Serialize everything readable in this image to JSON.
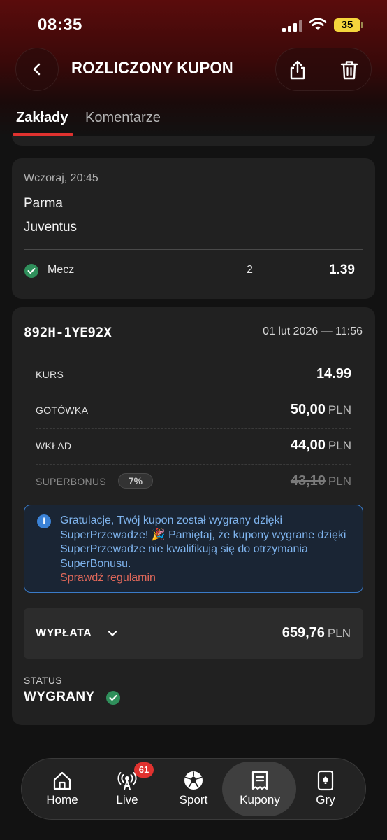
{
  "status_bar": {
    "time": "08:35",
    "battery": "35"
  },
  "header": {
    "title": "ROZLICZONY KUPON"
  },
  "tabs": [
    {
      "label": "Zakłady",
      "active": true
    },
    {
      "label": "Komentarze",
      "active": false
    }
  ],
  "bet": {
    "date": "Wczoraj, 20:45",
    "team_home": "Parma",
    "team_away": "Juventus",
    "market": "Mecz",
    "selection": "2",
    "odds": "1.39",
    "status_icon": "check-icon"
  },
  "coupon": {
    "id": "892H-1YE92X",
    "datetime": "01 lut 2026 — 11:56",
    "rows": {
      "kurs": {
        "label": "KURS",
        "value": "14.99"
      },
      "cash": {
        "label": "GOTÓWKA",
        "value": "50,00",
        "currency": "PLN"
      },
      "stake": {
        "label": "WKŁAD",
        "value": "44,00",
        "currency": "PLN"
      },
      "superbonus": {
        "label": "SUPERBONUS",
        "badge": "7%",
        "value": "43,10",
        "currency": "PLN"
      }
    },
    "info": {
      "text": "Gratulacje, Twój kupon został wygrany dzięki SuperPrzewadze! 🎉 Pamiętaj, że kupony wygrane dzięki SuperPrzewadze nie kwalifikują się do otrzymania SuperBonusu.",
      "link": "Sprawdź regulamin"
    },
    "payout": {
      "label": "WYPŁATA",
      "value": "659,76",
      "currency": "PLN"
    },
    "status": {
      "label": "STATUS",
      "value": "WYGRANY"
    }
  },
  "nav": {
    "items": [
      {
        "label": "Home",
        "icon": "home-icon"
      },
      {
        "label": "Live",
        "icon": "live-icon",
        "badge": "61"
      },
      {
        "label": "Sport",
        "icon": "soccer-ball-icon"
      },
      {
        "label": "Kupony",
        "icon": "receipt-icon",
        "active": true
      },
      {
        "label": "Gry",
        "icon": "card-icon"
      }
    ]
  },
  "colors": {
    "accent": "#e0322f",
    "success": "#2f8f5b",
    "info_border": "#3a7bc8",
    "info_text": "#7fb4ee",
    "link": "#e0685a"
  }
}
